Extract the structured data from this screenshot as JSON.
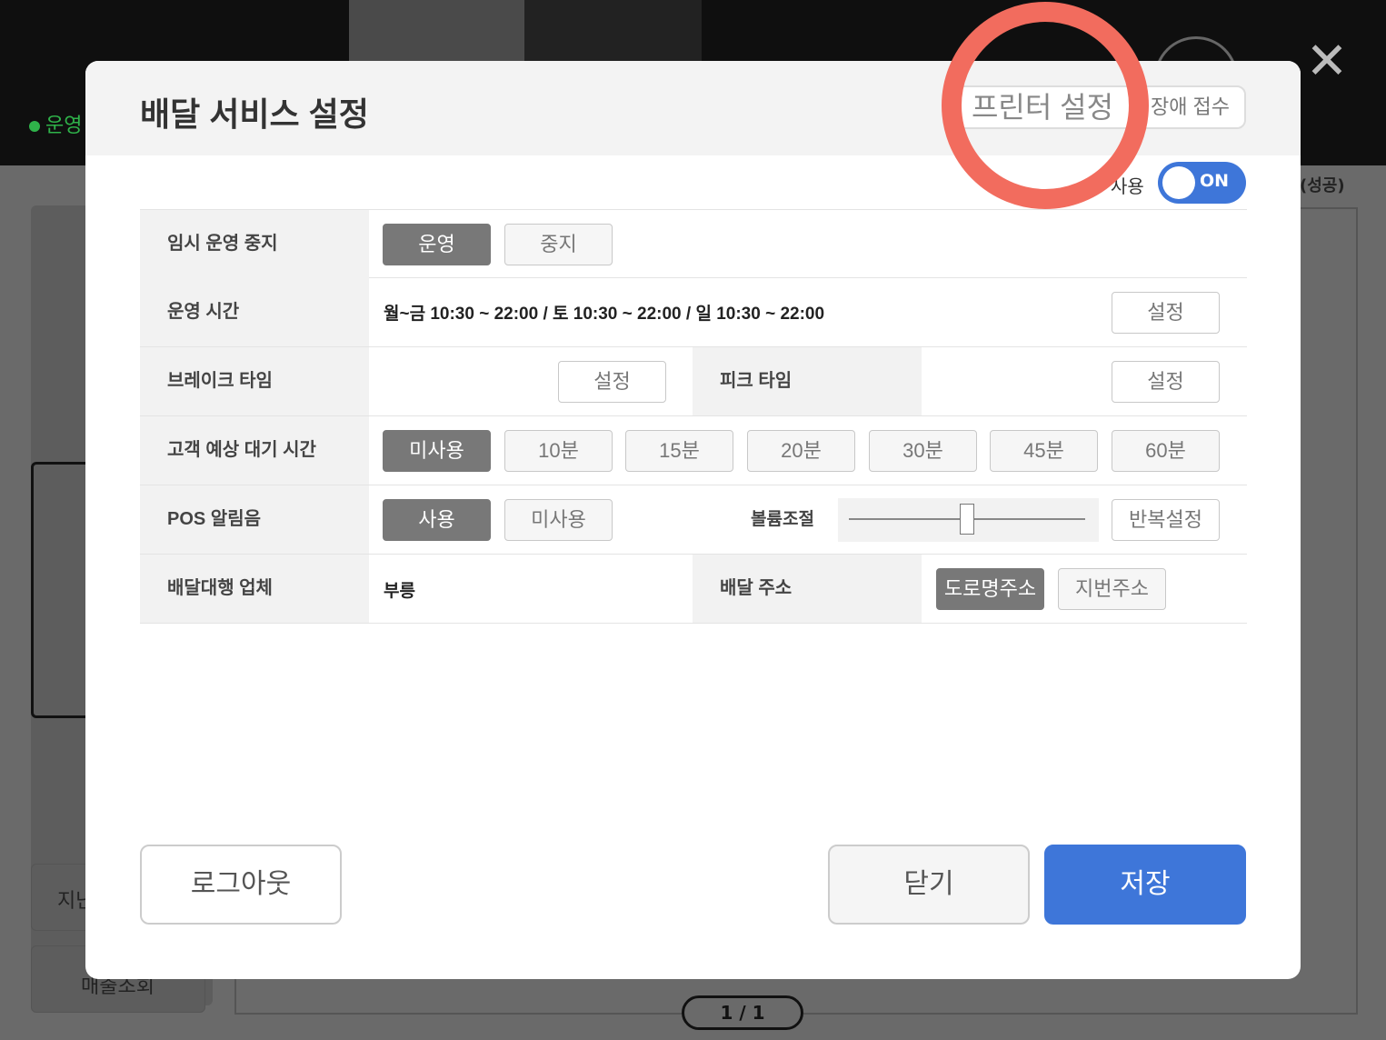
{
  "background": {
    "status_text": "운영",
    "success_text": "(성공)",
    "left_buttons": [
      "지난",
      "매출조회"
    ],
    "pager": "1 / 1"
  },
  "modal": {
    "title": "배달 서비스 설정",
    "printer_button": "프린터 설정",
    "report_button": "장애 접수",
    "toggle_label": "사용",
    "toggle_state": "ON",
    "rows": {
      "pause": {
        "label": "임시 운영 중지",
        "options": [
          "운영",
          "중지"
        ],
        "selected": "운영"
      },
      "hours": {
        "label": "운영 시간",
        "value": "월~금 10:30 ~ 22:00 / 토 10:30 ~ 22:00 / 일 10:30 ~ 22:00",
        "button": "설정"
      },
      "break": {
        "label": "브레이크 타임",
        "button": "설정",
        "label2": "피크 타임",
        "button2": "설정"
      },
      "wait": {
        "label": "고객 예상 대기 시간",
        "options": [
          "미사용",
          "10분",
          "15분",
          "20분",
          "30분",
          "45분",
          "60분"
        ],
        "selected": "미사용"
      },
      "pos": {
        "label": "POS 알림음",
        "options": [
          "사용",
          "미사용"
        ],
        "selected": "사용",
        "volume_label": "볼륨조절",
        "volume": 0.5,
        "repeat_button": "반복설정"
      },
      "agency": {
        "label": "배달대행 업체",
        "value": "부릉",
        "label2": "배달 주소",
        "options": [
          "도로명주소",
          "지번주소"
        ],
        "selected": "도로명주소"
      }
    },
    "footer": {
      "logout": "로그아웃",
      "close": "닫기",
      "save": "저장"
    }
  },
  "colors": {
    "accent": "#3e76d9",
    "selected_option": "#787878",
    "highlight": "#f26c5e",
    "status_green": "#2fb34a"
  }
}
